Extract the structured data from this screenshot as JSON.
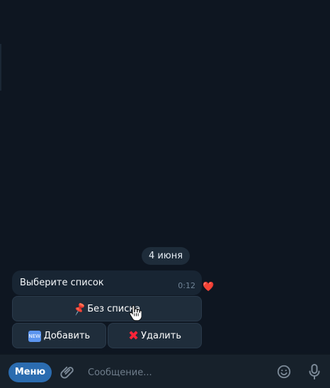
{
  "chat": {
    "date": "4 июня",
    "message": {
      "text": "Выберите список",
      "time": "0:12",
      "reaction": "❤️"
    },
    "keyboard": {
      "main": {
        "icon": "pushpin-icon",
        "label": "Без списка"
      },
      "add": {
        "icon": "new-badge-icon",
        "badge_text": "NEW",
        "label": "Добавить"
      },
      "delete": {
        "icon": "cross-mark-icon",
        "label": "Удалить"
      }
    }
  },
  "composer": {
    "menu_label": "Меню",
    "placeholder": "Сообщение...",
    "attach_icon": "paperclip-icon",
    "emoji_icon": "smile-icon",
    "mic_icon": "microphone-icon"
  },
  "colors": {
    "background": "#0e1621",
    "bubble": "#182533",
    "keyboard_button": "#1f2d3b",
    "menu_button": "#2b6cb0",
    "reaction": "#ff3b45"
  }
}
